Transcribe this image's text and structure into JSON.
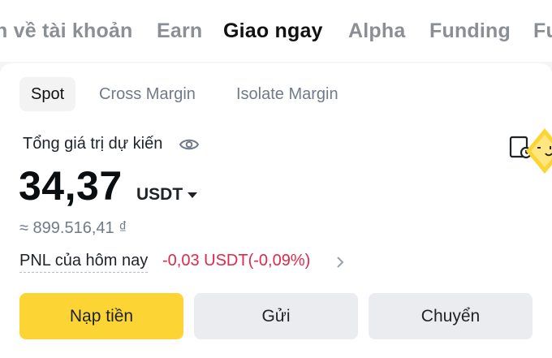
{
  "topnav": {
    "tabs": [
      {
        "label": "n về tài khoản",
        "active": false
      },
      {
        "label": "Earn",
        "active": false
      },
      {
        "label": "Giao ngay",
        "active": true
      },
      {
        "label": "Alpha",
        "active": false
      },
      {
        "label": "Funding",
        "active": false
      },
      {
        "label": "Fu",
        "active": false
      }
    ]
  },
  "subtabs": [
    {
      "label": "Spot",
      "active": true
    },
    {
      "label": "Cross Margin",
      "active": false
    },
    {
      "label": "Isolate Margin",
      "active": false
    }
  ],
  "balance": {
    "label": "Tổng giá trị dự kiến",
    "value": "34,37",
    "currency": "USDT",
    "approx_local": "≈ 899.516,41 ₫"
  },
  "pnl": {
    "label": "PNL của hôm nay",
    "value": "-0,03 USDT(-0,09%)"
  },
  "actions": {
    "deposit": "Nạp tiền",
    "send": "Gửi",
    "transfer": "Chuyển"
  },
  "icons": {
    "eye": "eye-icon",
    "wallet": "wallet-history-icon",
    "caret": "caret-down-icon",
    "chevron": "chevron-right-icon"
  },
  "colors": {
    "accent": "#fcd535",
    "negative": "#e0294a",
    "muted": "#707a8a"
  }
}
